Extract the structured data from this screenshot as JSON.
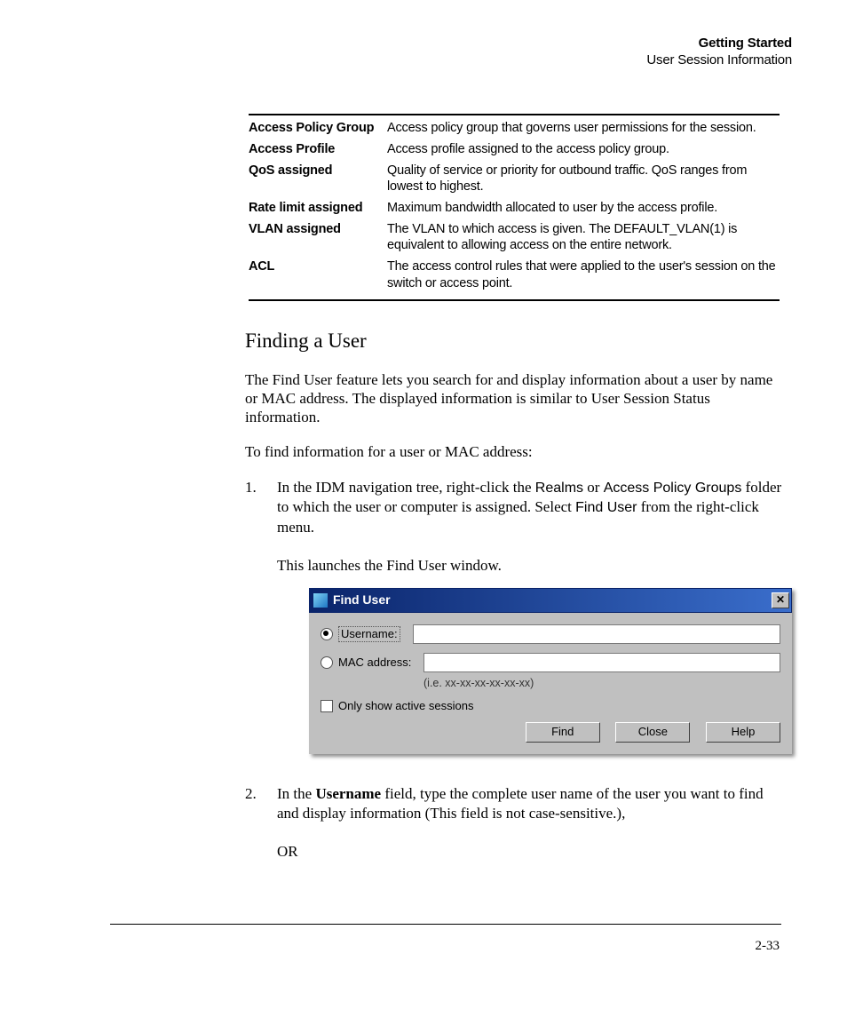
{
  "header": {
    "h1": "Getting Started",
    "h2": "User Session Information"
  },
  "table": [
    {
      "term": "Access Policy Group",
      "def": "Access policy group that governs user permissions for the session."
    },
    {
      "term": "Access Profile",
      "def": "Access profile assigned to the access policy group."
    },
    {
      "term": "QoS assigned",
      "def": "Quality of service or priority for outbound traffic. QoS ranges from lowest to highest."
    },
    {
      "term": "Rate limit assigned",
      "def": "Maximum bandwidth allocated to user by the access profile."
    },
    {
      "term": "VLAN assigned",
      "def": "The VLAN to which access is given. The DEFAULT_VLAN(1) is equivalent to allowing access on the entire network."
    },
    {
      "term": "ACL",
      "def": "The access control rules that were applied to the user's session on the switch or access point."
    }
  ],
  "section_title": "Finding a User",
  "p1": "The Find User feature lets you search for and display information about a user by name or MAC address. The displayed information is similar to User Session Status information.",
  "p2": "To find information for a user or MAC address:",
  "step1": {
    "pre": "In the IDM navigation tree, right-click the ",
    "realms": "Realms",
    "mid1": " or ",
    "apg": "Access Policy Groups",
    "mid2": " folder to which the user or computer is assigned. Select ",
    "find": "Find User",
    "post": " from the right-click menu.",
    "tail": "This launches the Find User window."
  },
  "dialog": {
    "title": "Find User",
    "username_label": "Username:",
    "mac_label": "MAC address:",
    "hint": "(i.e. xx-xx-xx-xx-xx-xx)",
    "only_label": "Only show active sessions",
    "find": "Find",
    "close": "Close",
    "help": "Help",
    "close_x": "✕"
  },
  "step2": {
    "pre": "In the ",
    "bold": "Username",
    "post": " field, type the complete user name of the user you want to find and display information (This field is not case-sensitive.),",
    "or": "OR"
  },
  "pagenum": "2-33"
}
